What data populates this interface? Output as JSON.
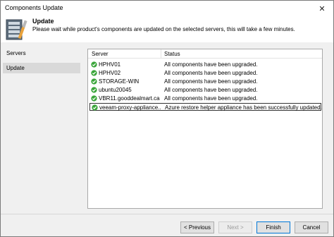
{
  "window": {
    "title": "Components Update"
  },
  "header": {
    "title": "Update",
    "description": "Please wait while product's components are updated on the selected servers, this will take a few minutes."
  },
  "sidebar": {
    "items": [
      {
        "label": "Servers"
      },
      {
        "label": "Update"
      }
    ]
  },
  "table": {
    "columns": [
      "Server",
      "Status"
    ],
    "rows": [
      {
        "server": "HPHV01",
        "status": "All components have been upgraded.",
        "icon": "success-check-icon"
      },
      {
        "server": "HPHV02",
        "status": "All components have been upgraded.",
        "icon": "success-check-icon"
      },
      {
        "server": "STORAGE-WIN",
        "status": "All components have been upgraded.",
        "icon": "success-check-icon"
      },
      {
        "server": "ubuntu20045",
        "status": "All components have been upgraded.",
        "icon": "success-check-icon"
      },
      {
        "server": "VBR11.gooddealmart.ca",
        "status": "All components have been upgraded.",
        "icon": "success-check-icon"
      },
      {
        "server": "veeam-proxy-appliance...",
        "status": "Azure restore helper appliance has been successfully updated.",
        "icon": "success-check-icon"
      }
    ]
  },
  "buttons": {
    "previous": "< Previous",
    "next": "Next >",
    "finish": "Finish",
    "cancel": "Cancel"
  },
  "colors": {
    "success": "#3aa53a",
    "selected_sidebar": "#d9d9d9",
    "panel_bg": "#f0f0f0"
  }
}
